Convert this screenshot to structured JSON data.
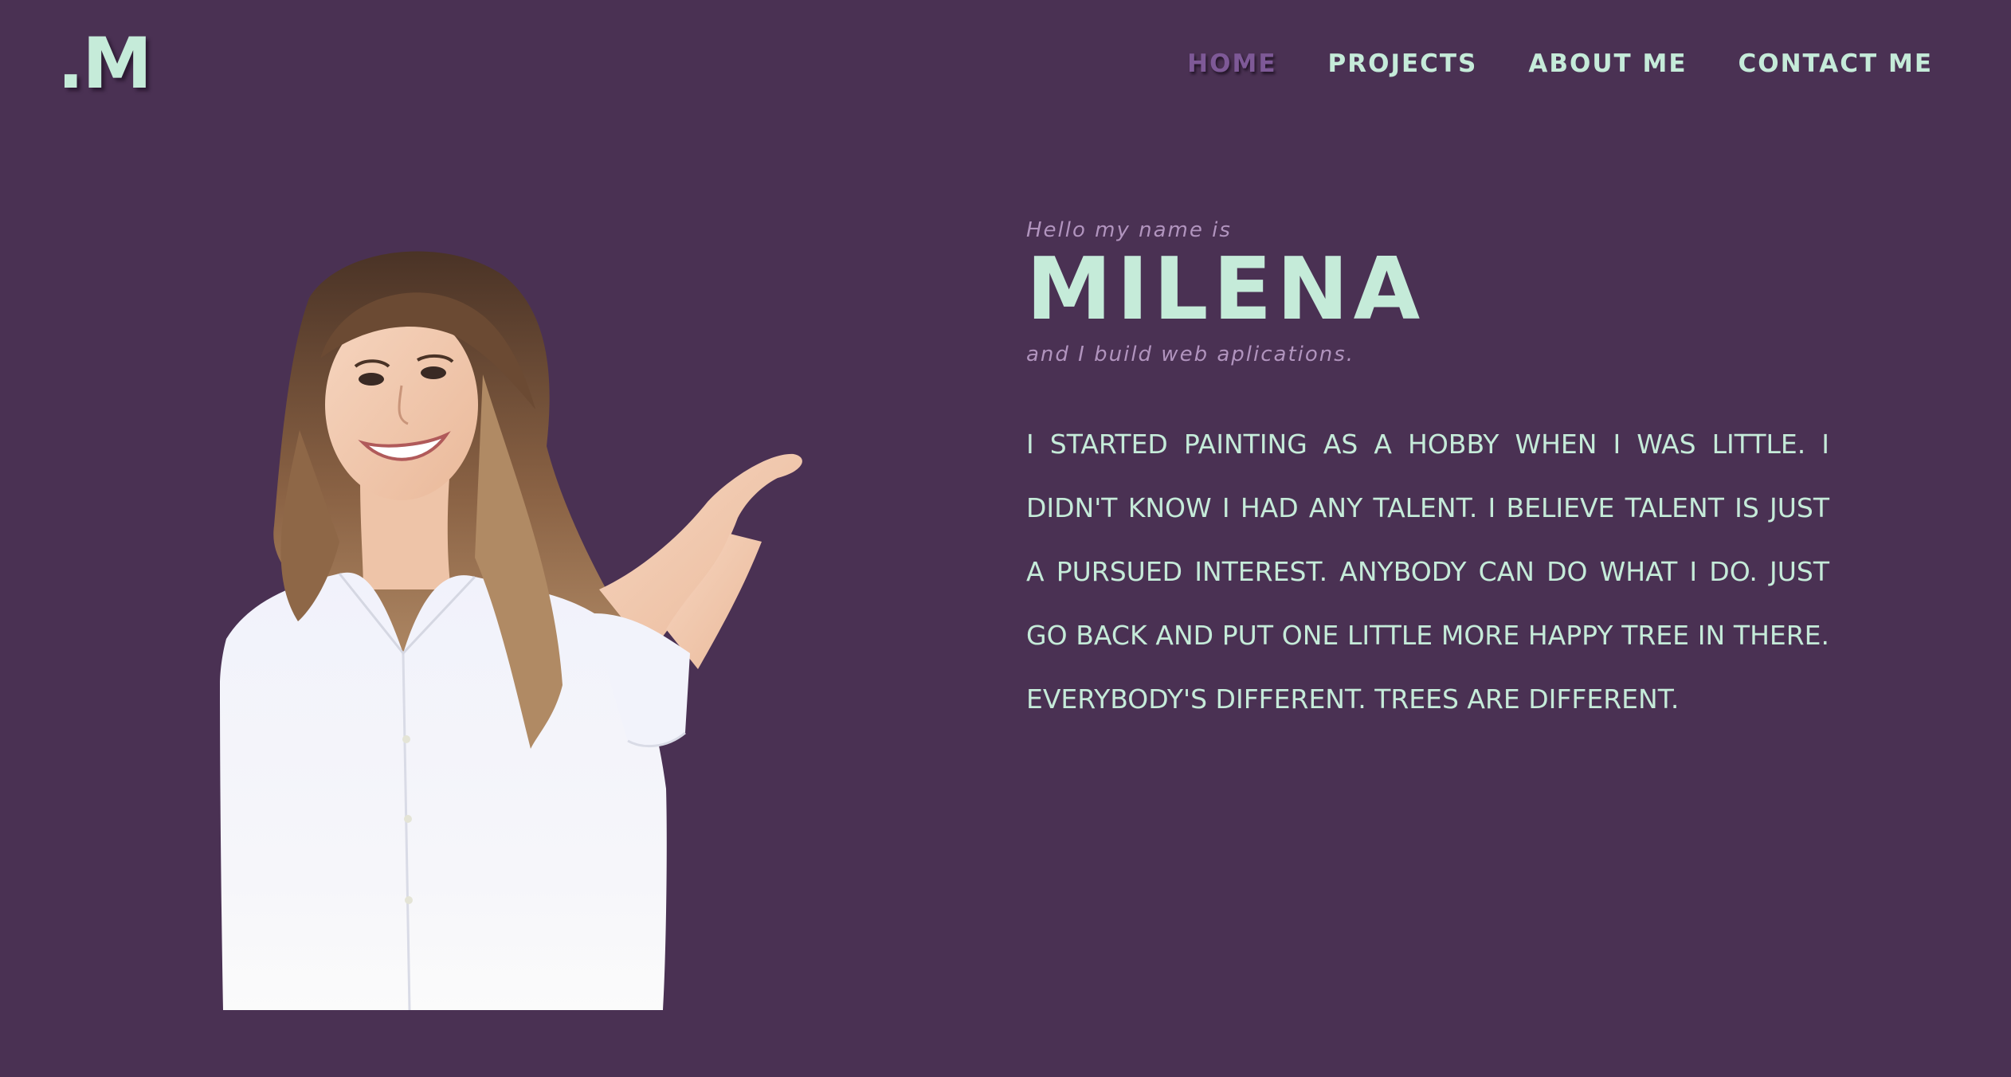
{
  "header": {
    "logo_text": ".M",
    "nav": [
      {
        "label": "HOME",
        "active": true
      },
      {
        "label": "PROJECTS",
        "active": false
      },
      {
        "label": "ABOUT ME",
        "active": false
      },
      {
        "label": "CONTACT ME",
        "active": false
      }
    ]
  },
  "hero": {
    "greeting": "Hello my name is",
    "name": "MILENA",
    "tagline": "and I build web aplications.",
    "bio": "I STARTED PAINTING AS A HOBBY WHEN I WAS LITTLE. I DIDN'T KNOW I HAD ANY TALENT. I BELIEVE TALENT IS JUST A PURSUED INTEREST. ANYBODY CAN DO WHAT I DO. JUST GO BACK AND PUT ONE LITTLE MORE HAPPY TREE IN THERE. EVERYBODY'S DIFFERENT. TREES ARE DIFFERENT.",
    "photo_subject": "smiling woman in white blouse pointing right"
  },
  "colors": {
    "background": "#4a3153",
    "accent_mint": "#c5ebd9",
    "nav_active": "#7e5997",
    "muted_lilac": "#b194be"
  }
}
